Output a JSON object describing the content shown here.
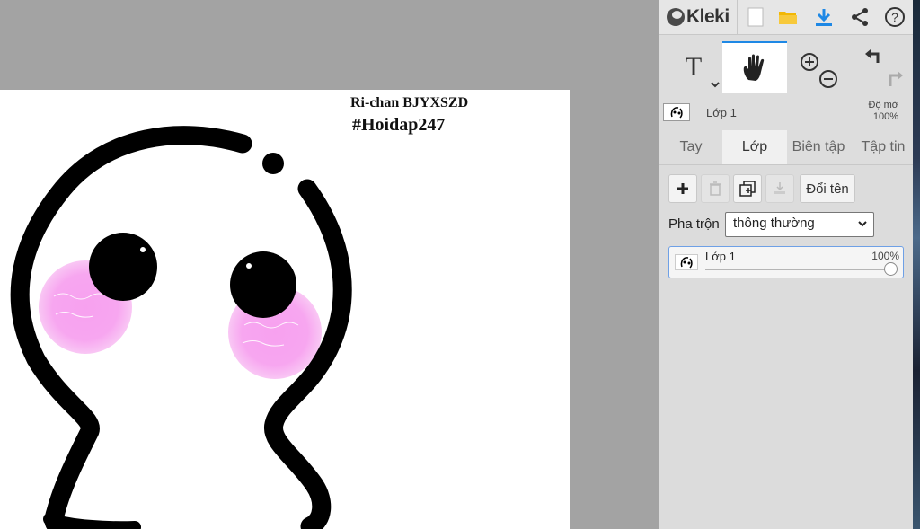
{
  "app": {
    "name": "Kleki"
  },
  "canvas": {
    "caption_line1": "Ri-chan BJYXSZD",
    "caption_line2": "#Hoidap247"
  },
  "toolbar": {
    "buttons": [
      {
        "name": "new-image",
        "icon": "new-file-icon"
      },
      {
        "name": "open",
        "icon": "folder-icon"
      },
      {
        "name": "save",
        "icon": "download-icon"
      },
      {
        "name": "share",
        "icon": "share-icon"
      },
      {
        "name": "help",
        "icon": "help-icon"
      }
    ]
  },
  "tools": {
    "text_tool_label": "T",
    "active_tool": "hand",
    "items": [
      "text",
      "hand",
      "zoom",
      "undo-redo"
    ]
  },
  "current_layer": {
    "name": "Lớp 1",
    "opacity_label": "Độ mờ",
    "opacity_value": "100%"
  },
  "tabs": [
    {
      "label": "Tay",
      "active": false
    },
    {
      "label": "Lớp",
      "active": true
    },
    {
      "label": "Biên tập",
      "active": false
    },
    {
      "label": "Tập tin",
      "active": false
    }
  ],
  "layers_panel": {
    "rename_label": "Đổi tên",
    "blend_label": "Pha trộn",
    "blend_value": "thông thường",
    "layers": [
      {
        "name": "Lớp 1",
        "opacity": "100%",
        "opacity_fraction": 1.0
      }
    ]
  },
  "colors": {
    "accent": "#1e88e5",
    "folder": "#f2b705",
    "panel": "#dddddd",
    "workspace": "#a3a3a3",
    "blush": "#f7a1ef"
  }
}
